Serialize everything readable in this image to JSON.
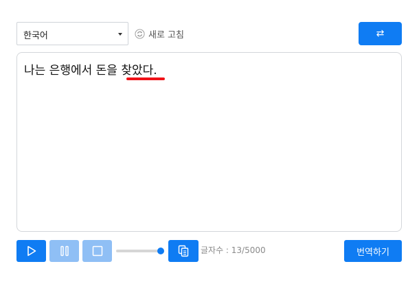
{
  "toolbar": {
    "language_selected": "한국어",
    "refresh_label": "새로 고침",
    "swap_symbol": "⇄"
  },
  "editor": {
    "text": "나는 은행에서 돈을 찾았다."
  },
  "footer": {
    "char_count": "글자수 : 13/5000",
    "translate_label": "번역하기"
  },
  "colors": {
    "accent": "#0f7cf3",
    "accent_disabled": "#8fbff5",
    "error_underline": "#f01218"
  },
  "icons": [
    "refresh-icon",
    "swap-icon",
    "play-icon",
    "pause-icon",
    "stop-icon",
    "copy-icon"
  ]
}
